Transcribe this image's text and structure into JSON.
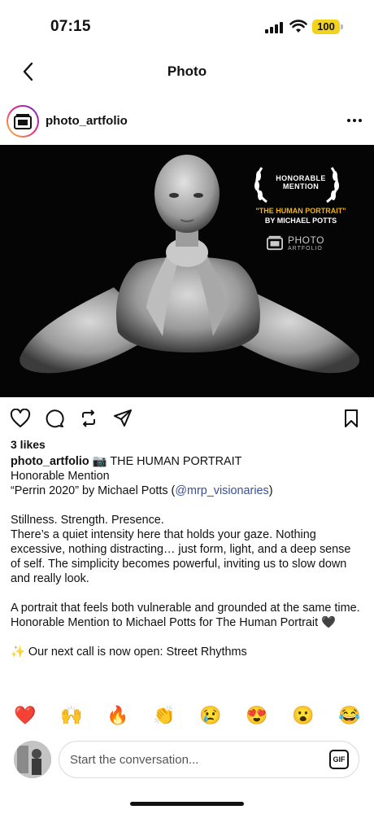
{
  "status": {
    "time": "07:15",
    "battery": "100"
  },
  "nav": {
    "title": "Photo",
    "back_icon": "chevron-left-icon"
  },
  "post": {
    "username": "photo_artfolio",
    "image": {
      "award_line1": "HONORABLE",
      "award_line2": "MENTION",
      "award_title": "\"THE HUMAN PORTRAIT\"",
      "award_by": "BY MICHAEL POTTS",
      "brand_line1": "PHOTO",
      "brand_line2": "ARTFOLIO"
    },
    "likes": "3 likes",
    "caption": {
      "user": "photo_artfolio",
      "line1": " 📷 THE HUMAN PORTRAIT",
      "line2": "Honorable Mention",
      "line3_pre": "“Perrin 2020” by Michael Potts (",
      "mention": "@mrp_visionaries",
      "line3_post": ")",
      "para2": "Stillness. Strength. Presence.",
      "para2b": "There’s a quiet intensity here that holds your gaze. Nothing excessive, nothing distracting… just form, light, and a deep sense of self. The simplicity becomes powerful, inviting us to slow down and really look.",
      "para3": "A portrait that feels both vulnerable and grounded at the same time.",
      "para3b": "Honorable Mention to Michael Potts for The Human Portrait 🖤",
      "para4": "✨ Our next call is now open: Street Rhythms"
    }
  },
  "reactions": [
    "❤️",
    "🙌",
    "🔥",
    "👏",
    "😢",
    "😍",
    "😮",
    "😂"
  ],
  "composer": {
    "placeholder": "Start the conversation...",
    "gif_label": "GIF"
  }
}
